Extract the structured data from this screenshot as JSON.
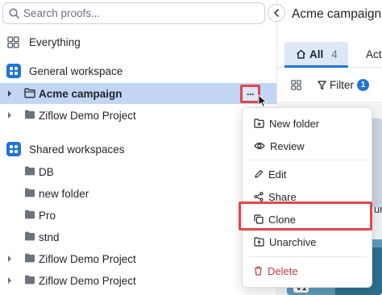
{
  "search": {
    "placeholder": "Search proofs..."
  },
  "sidebar": {
    "everything": "Everything",
    "general_workspace": "General workspace",
    "general_items": [
      {
        "label": "Acme campaign",
        "selected": true
      },
      {
        "label": "Ziflow Demo Project",
        "selected": false
      }
    ],
    "shared_workspaces": "Shared workspaces",
    "shared_items": [
      {
        "label": "DB"
      },
      {
        "label": "new folder"
      },
      {
        "label": "Pro"
      },
      {
        "label": "stnd"
      },
      {
        "label": "Ziflow Demo Project"
      },
      {
        "label": "Ziflow Demo Project"
      }
    ],
    "more_label": "···"
  },
  "main": {
    "title": "Acme campaign",
    "tabs": [
      {
        "label": "All",
        "count": "4",
        "active": true
      },
      {
        "label": "Act",
        "active": false
      }
    ],
    "filter_label": "Filter",
    "filter_count": "1",
    "version_badge": "V1",
    "peek_text": "un"
  },
  "context_menu": {
    "items": [
      {
        "label": "New folder",
        "icon": "new-folder-icon"
      },
      {
        "label": "Review",
        "icon": "eye-icon"
      },
      {
        "label": "Edit",
        "icon": "pencil-icon"
      },
      {
        "label": "Share",
        "icon": "share-icon"
      },
      {
        "label": "Clone",
        "icon": "copy-icon"
      },
      {
        "label": "Unarchive",
        "icon": "unarchive-folder-icon",
        "highlighted": true
      },
      {
        "label": "Delete",
        "icon": "trash-icon",
        "danger": true
      }
    ]
  },
  "colors": {
    "accent": "#1f74d6",
    "selected_row": "#c2d5f5",
    "highlight_box": "#e0474c",
    "danger": "#c0393f"
  }
}
